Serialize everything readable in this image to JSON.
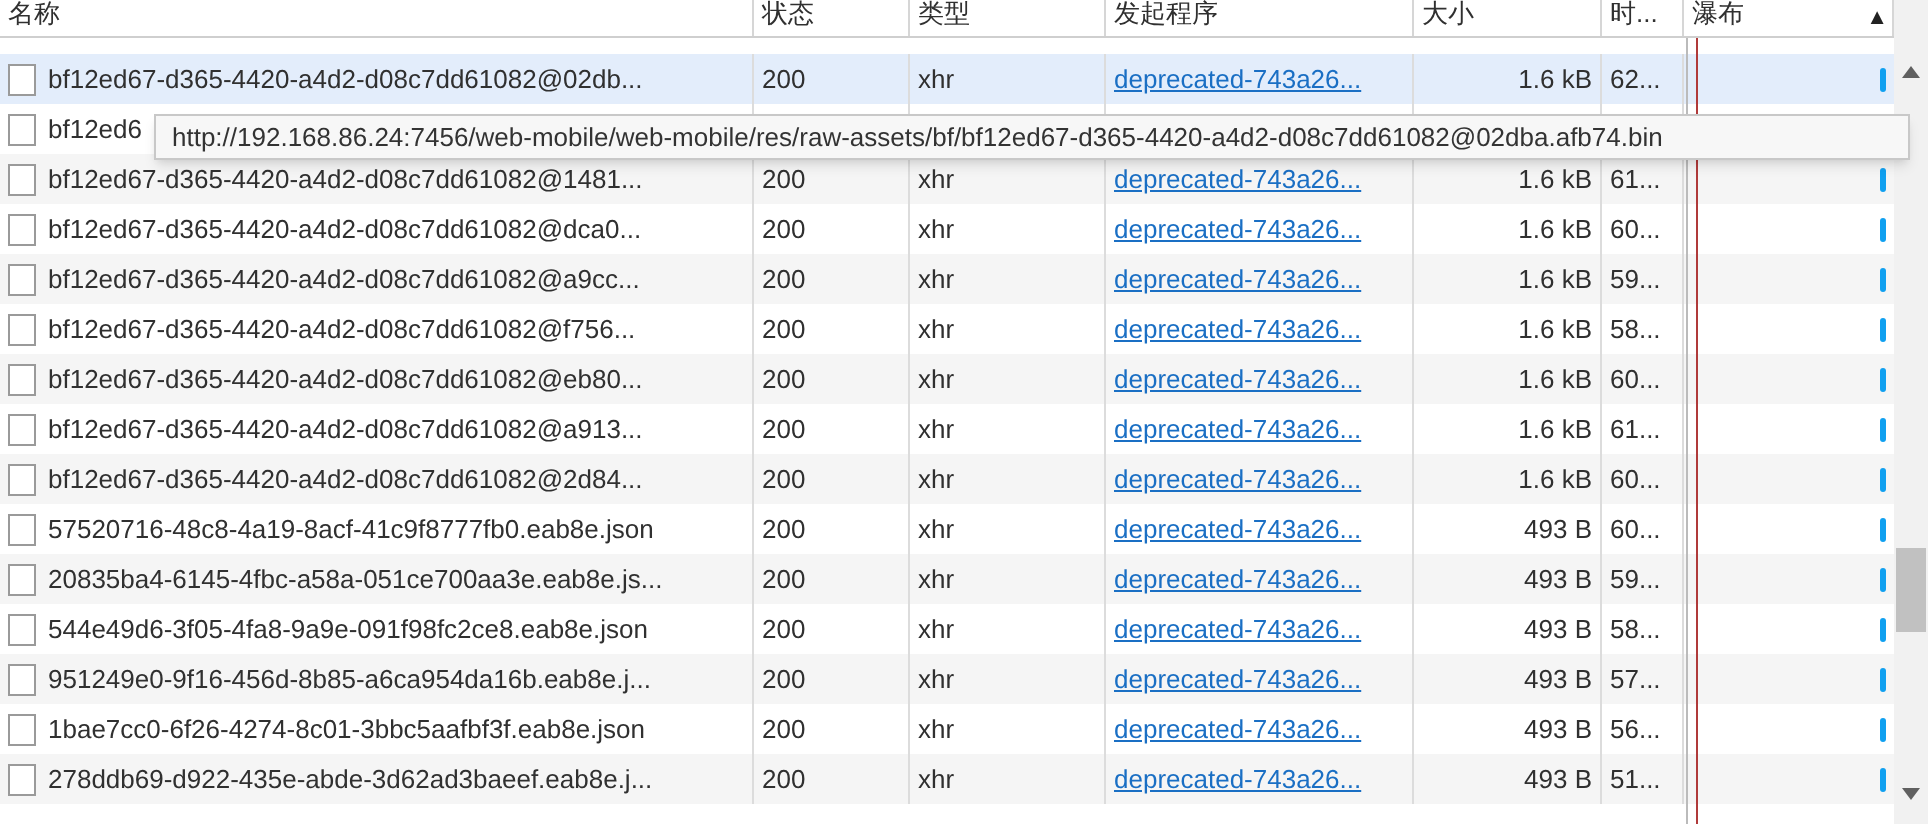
{
  "columns": [
    "名称",
    "状态",
    "类型",
    "发起程序",
    "大小",
    "时...",
    "瀑布"
  ],
  "sort_indicator": "▲",
  "rows": [
    {
      "name": "bf12ed67-d365-4420-a4d2-d08c7dd61082@02db...",
      "status": "200",
      "type": "xhr",
      "initiator": "deprecated-743a26...",
      "size": "1.6 kB",
      "time": "62...",
      "selected": true
    },
    {
      "name": "bf12ed6",
      "selected": false
    },
    {
      "name": "bf12ed67-d365-4420-a4d2-d08c7dd61082@1481...",
      "status": "200",
      "type": "xhr",
      "initiator": "deprecated-743a26...",
      "size": "1.6 kB",
      "time": "61...",
      "selected": false
    },
    {
      "name": "bf12ed67-d365-4420-a4d2-d08c7dd61082@dca0...",
      "status": "200",
      "type": "xhr",
      "initiator": "deprecated-743a26...",
      "size": "1.6 kB",
      "time": "60...",
      "selected": false
    },
    {
      "name": "bf12ed67-d365-4420-a4d2-d08c7dd61082@a9cc...",
      "status": "200",
      "type": "xhr",
      "initiator": "deprecated-743a26...",
      "size": "1.6 kB",
      "time": "59...",
      "selected": false
    },
    {
      "name": "bf12ed67-d365-4420-a4d2-d08c7dd61082@f756...",
      "status": "200",
      "type": "xhr",
      "initiator": "deprecated-743a26...",
      "size": "1.6 kB",
      "time": "58...",
      "selected": false
    },
    {
      "name": "bf12ed67-d365-4420-a4d2-d08c7dd61082@eb80...",
      "status": "200",
      "type": "xhr",
      "initiator": "deprecated-743a26...",
      "size": "1.6 kB",
      "time": "60...",
      "selected": false
    },
    {
      "name": "bf12ed67-d365-4420-a4d2-d08c7dd61082@a913...",
      "status": "200",
      "type": "xhr",
      "initiator": "deprecated-743a26...",
      "size": "1.6 kB",
      "time": "61...",
      "selected": false
    },
    {
      "name": "bf12ed67-d365-4420-a4d2-d08c7dd61082@2d84...",
      "status": "200",
      "type": "xhr",
      "initiator": "deprecated-743a26...",
      "size": "1.6 kB",
      "time": "60...",
      "selected": false
    },
    {
      "name": "57520716-48c8-4a19-8acf-41c9f8777fb0.eab8e.json",
      "status": "200",
      "type": "xhr",
      "initiator": "deprecated-743a26...",
      "size": "493 B",
      "time": "60...",
      "selected": false
    },
    {
      "name": "20835ba4-6145-4fbc-a58a-051ce700aa3e.eab8e.js...",
      "status": "200",
      "type": "xhr",
      "initiator": "deprecated-743a26...",
      "size": "493 B",
      "time": "59...",
      "selected": false
    },
    {
      "name": "544e49d6-3f05-4fa8-9a9e-091f98fc2ce8.eab8e.json",
      "status": "200",
      "type": "xhr",
      "initiator": "deprecated-743a26...",
      "size": "493 B",
      "time": "58...",
      "selected": false
    },
    {
      "name": "951249e0-9f16-456d-8b85-a6ca954da16b.eab8e.j...",
      "status": "200",
      "type": "xhr",
      "initiator": "deprecated-743a26...",
      "size": "493 B",
      "time": "57...",
      "selected": false
    },
    {
      "name": "1bae7cc0-6f26-4274-8c01-3bbc5aafbf3f.eab8e.json",
      "status": "200",
      "type": "xhr",
      "initiator": "deprecated-743a26...",
      "size": "493 B",
      "time": "56...",
      "selected": false
    },
    {
      "name": "278ddb69-d922-435e-abde-3d62ad3baeef.eab8e.j...",
      "status": "200",
      "type": "xhr",
      "initiator": "deprecated-743a26...",
      "size": "493 B",
      "time": "51...",
      "selected": false
    }
  ],
  "tooltip": "http://192.168.86.24:7456/web-mobile/web-mobile/res/raw-assets/bf/bf12ed67-d365-4420-a4d2-d08c7dd61082@02dba.afb74.bin"
}
